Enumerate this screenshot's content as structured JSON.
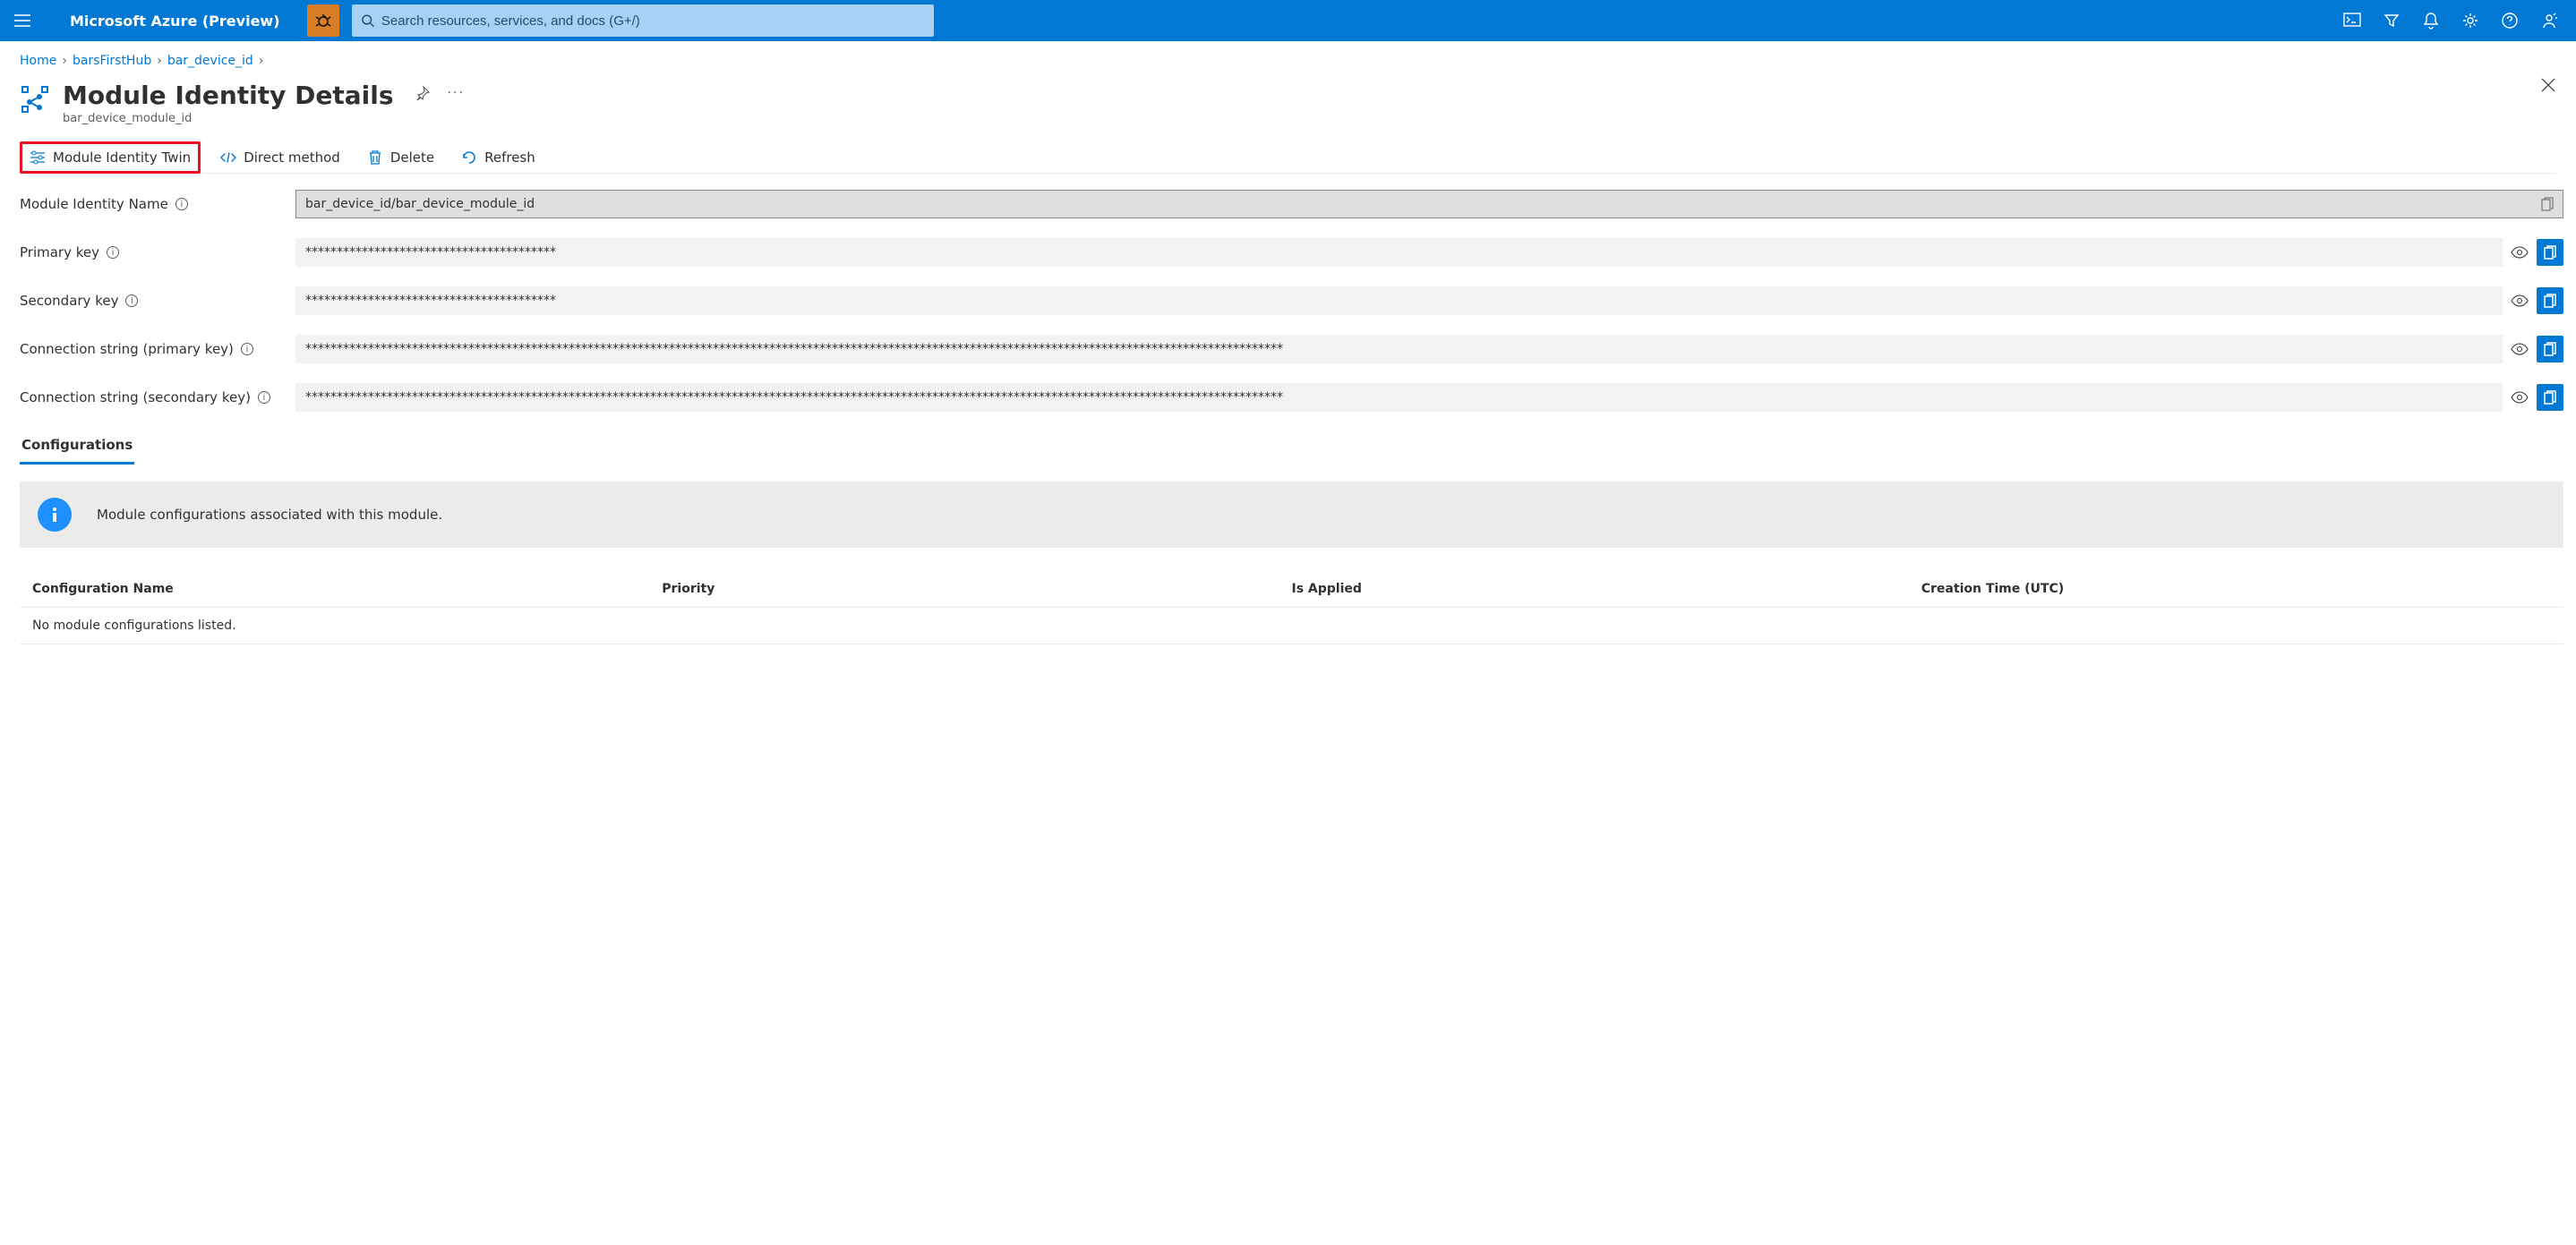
{
  "brand": "Microsoft Azure (Preview)",
  "search": {
    "placeholder": "Search resources, services, and docs (G+/)"
  },
  "breadcrumb": {
    "items": [
      "Home",
      "barsFirstHub",
      "bar_device_id"
    ]
  },
  "page": {
    "title": "Module Identity Details",
    "subtitle": "bar_device_module_id"
  },
  "toolbar": {
    "twin": "Module Identity Twin",
    "direct": "Direct method",
    "delete": "Delete",
    "refresh": "Refresh"
  },
  "fields": {
    "name_label": "Module Identity Name",
    "name_value": "bar_device_id/bar_device_module_id",
    "primary_label": "Primary key",
    "primary_value": "****************************************",
    "secondary_label": "Secondary key",
    "secondary_value": "****************************************",
    "conn_primary_label": "Connection string (primary key)",
    "conn_primary_value": "************************************************************************************************************************************************************",
    "conn_secondary_label": "Connection string (secondary key)",
    "conn_secondary_value": "************************************************************************************************************************************************************"
  },
  "tabs": {
    "configurations": "Configurations"
  },
  "banner": {
    "message": "Module configurations associated with this module."
  },
  "table": {
    "cols": [
      "Configuration Name",
      "Priority",
      "Is Applied",
      "Creation Time (UTC)"
    ],
    "empty": "No module configurations listed."
  }
}
